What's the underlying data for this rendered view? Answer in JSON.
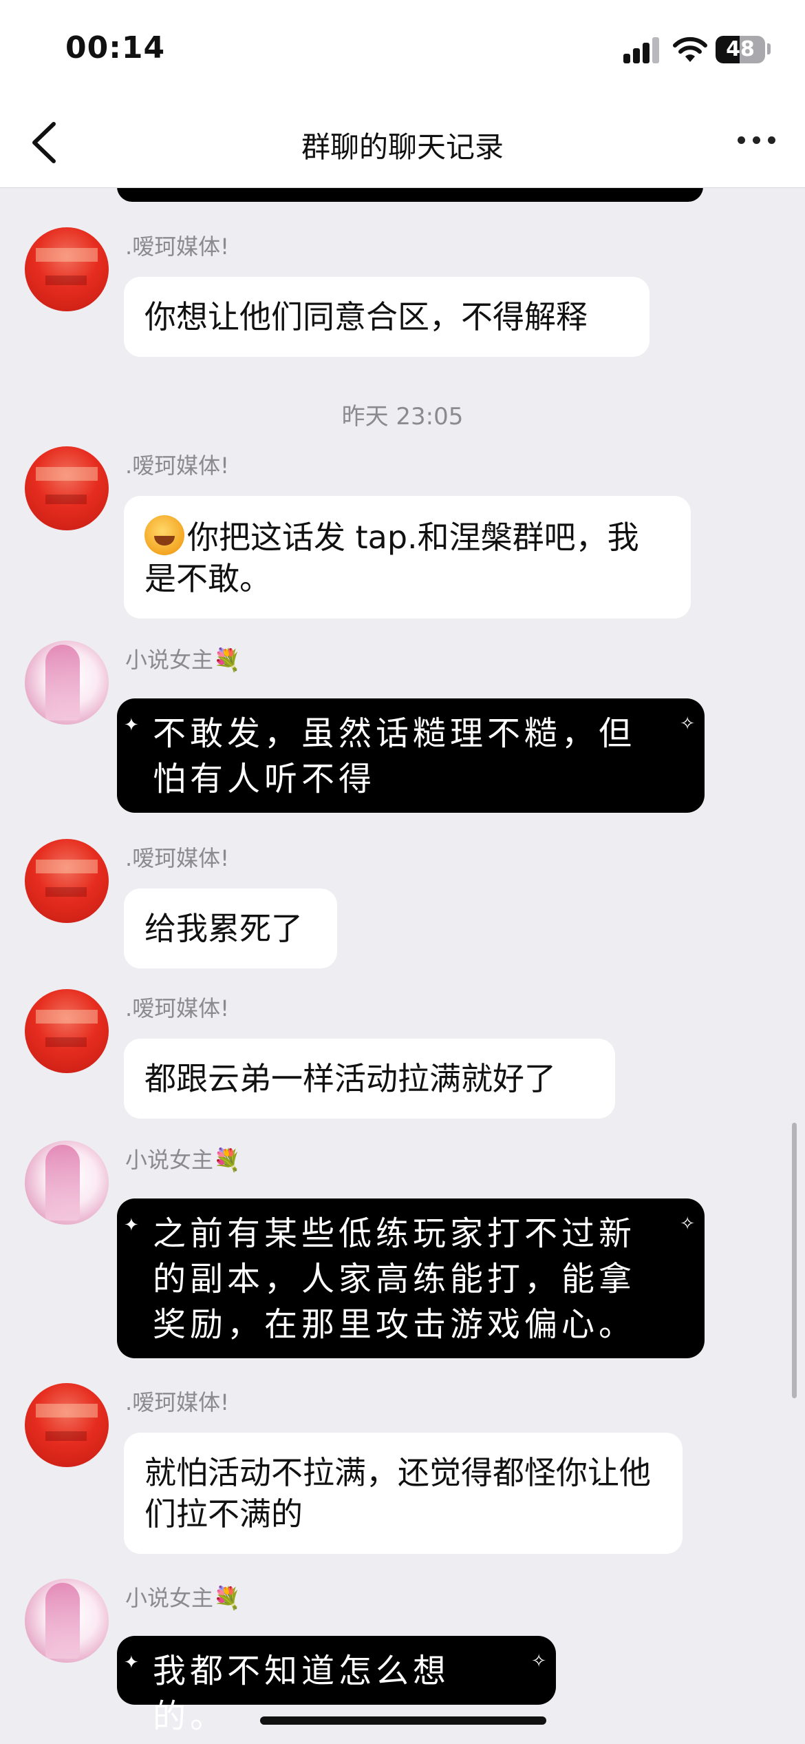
{
  "status_bar": {
    "time": "00:14",
    "battery": "48",
    "signal_bars_lit": 3,
    "signal_bars_total": 4
  },
  "header": {
    "title": "群聊的聊天记录",
    "back_icon": "chevron-left-icon",
    "more_icon": "more-dots-icon"
  },
  "timestamp": "昨天 23:05",
  "messages": [
    {
      "sender": ".嗳珂媒体!",
      "text": "你想让他们同意合区，不得解释"
    },
    {
      "sender": ".嗳珂媒体!",
      "text": "你把这话发 tap.和涅槃群吧，我是不敢。"
    },
    {
      "sender": "小说女主💐",
      "text": "不敢发，虽然话糙理不糙，但怕有人听不得"
    },
    {
      "sender": ".嗳珂媒体!",
      "text": "给我累死了"
    },
    {
      "sender": ".嗳珂媒体!",
      "text": "都跟云弟一样活动拉满就好了"
    },
    {
      "sender": "小说女主💐",
      "text": "之前有某些低练玩家打不过新的副本，人家高练能打，能拿奖励，在那里攻击游戏偏心。"
    },
    {
      "sender": ".嗳珂媒体!",
      "text": "就怕活动不拉满，还觉得都怪你让他们拉不满的"
    },
    {
      "sender": "小说女主💐",
      "text": "我都不知道怎么想的。"
    }
  ]
}
